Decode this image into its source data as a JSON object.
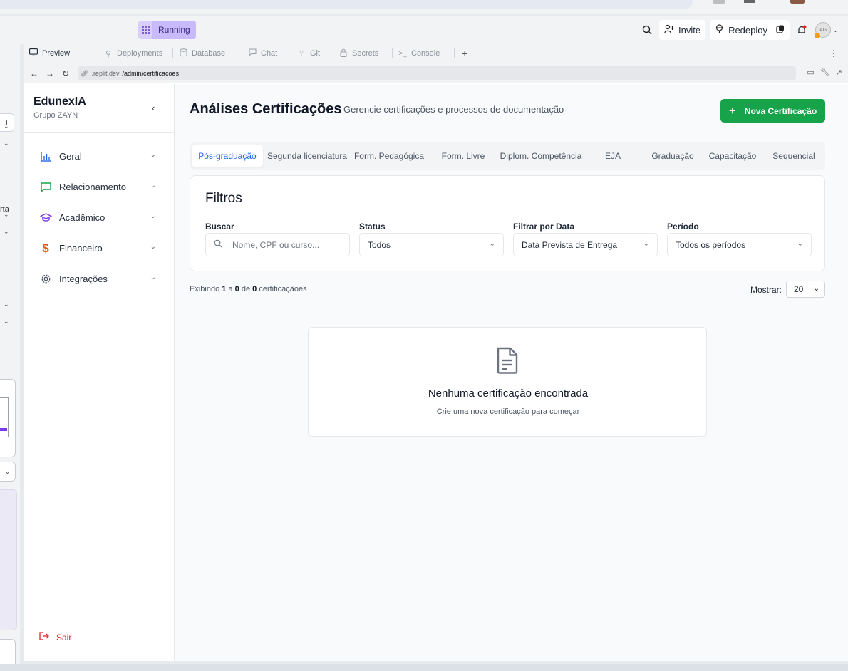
{
  "topbar": {
    "status_label": "Running",
    "invite_label": "Invite",
    "redeploy_label": "Redeploy",
    "avatar_initials": "AG"
  },
  "left_panel": {
    "partial_text": "rta"
  },
  "tabs": [
    {
      "label": "Preview",
      "icon": "monitor-icon"
    },
    {
      "label": "Deployments",
      "icon": "deploy-icon"
    },
    {
      "label": "Database",
      "icon": "database-icon"
    },
    {
      "label": "Chat",
      "icon": "chat-icon"
    },
    {
      "label": "Git",
      "icon": "git-icon"
    },
    {
      "label": "Secrets",
      "icon": "lock-icon"
    },
    {
      "label": "Console",
      "icon": "terminal-icon"
    }
  ],
  "url": {
    "domain": ".replit.dev",
    "path": "/admin/certificacoes"
  },
  "sidebar": {
    "brand_title": "EdunexIA",
    "brand_subtitle": "Grupo ZAYN",
    "items": [
      {
        "label": "Geral",
        "icon": "chart-icon",
        "color": "#2563eb"
      },
      {
        "label": "Relacionamento",
        "icon": "message-icon",
        "color": "#16a34a"
      },
      {
        "label": "Acadêmico",
        "icon": "graduation-cap-icon",
        "color": "#7c3aed"
      },
      {
        "label": "Financeiro",
        "icon": "dollar-icon",
        "color": "#ea580c"
      },
      {
        "label": "Integrações",
        "icon": "gear-icon",
        "color": "#4b5563"
      }
    ],
    "logout_label": "Sair"
  },
  "main": {
    "title": "Análises Certificações",
    "subtitle": "Gerencie certificações e processos de documentação",
    "new_button_label": "Nova Certificação",
    "category_tabs": [
      "Pós-graduação",
      "Segunda licenciatura",
      "Form. Pedagógica",
      "Form. Livre",
      "Diplom. Competência",
      "EJA",
      "Graduação",
      "Capacitação",
      "Sequencial"
    ],
    "active_tab": "Pós-graduação",
    "filters": {
      "title": "Filtros",
      "search_label": "Buscar",
      "search_placeholder": "Nome, CPF ou curso...",
      "status_label": "Status",
      "status_value": "Todos",
      "date_filter_label": "Filtrar por Data",
      "date_filter_value": "Data Prevista de Entrega",
      "period_label": "Período",
      "period_value": "Todos os períodos"
    },
    "count": {
      "prefix": "Exibindo",
      "start": "1",
      "a": "a",
      "end": "0",
      "de": "de",
      "total": "0",
      "suffix": "certificaçãoes"
    },
    "show_label": "Mostrar:",
    "show_value": "20",
    "empty_title": "Nenhuma certificação encontrada",
    "empty_subtitle": "Crie uma nova certificação para começar"
  },
  "colors": {
    "accent_green": "#16a34a",
    "active_tab_blue": "#2563eb",
    "logout_red": "#dc2626",
    "running_purple": "#c9bbfb"
  }
}
